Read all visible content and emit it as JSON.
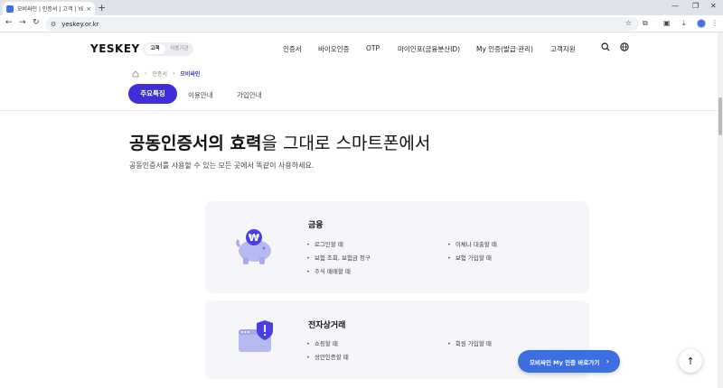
{
  "browser": {
    "tab_title": "모비싸인 | 인증서 | 고객 | YES",
    "close_glyph": "×",
    "new_tab_glyph": "+",
    "url": "yeskey.or.kr",
    "minimize_glyph": "—",
    "restore_glyph": "❐",
    "close_window_glyph": "✕"
  },
  "header": {
    "logo": "YESKEY",
    "segment": {
      "active": "고객",
      "inactive": "이용기관"
    },
    "nav": [
      "인증서",
      "바이오인증",
      "OTP",
      "마이인포(금융분산ID)",
      "My 인증(발급·관리)",
      "고객지원"
    ],
    "icons": [
      "search-icon",
      "globe-icon"
    ]
  },
  "breadcrumb": {
    "items": [
      "인증서",
      "모비싸인"
    ]
  },
  "subtabs": {
    "active": "주요특징",
    "items": [
      "이용안내",
      "가입안내"
    ]
  },
  "hero": {
    "title_bold": "공동인증서의 효력",
    "title_rest": "을 그대로 스마트폰에서",
    "description": "공동인증서를 사용할 수 있는 모든 곳에서 똑같이 사용하세요."
  },
  "cards": [
    {
      "title": "금융",
      "icon": "piggy-bank-icon",
      "left_items": [
        "로그인할 때",
        "보험 조회, 보험금 청구",
        "주식 매매할 때"
      ],
      "right_items": [
        "이체나 대출할 때",
        "보험 가입할 때"
      ]
    },
    {
      "title": "전자상거래",
      "icon": "browser-shield-icon",
      "left_items": [
        "쇼핑할 때",
        "성인인증할 때"
      ],
      "right_items": [
        "회원 가입할 때"
      ]
    }
  ],
  "floating": {
    "cta_label": "모비싸인 My 인증 바로가기",
    "cta_chevron": "›",
    "top_arrow": "↑"
  },
  "colors": {
    "accent": "#3f2fd6",
    "cta": "#3e6fe0",
    "card_bg": "#f5f6f9"
  }
}
